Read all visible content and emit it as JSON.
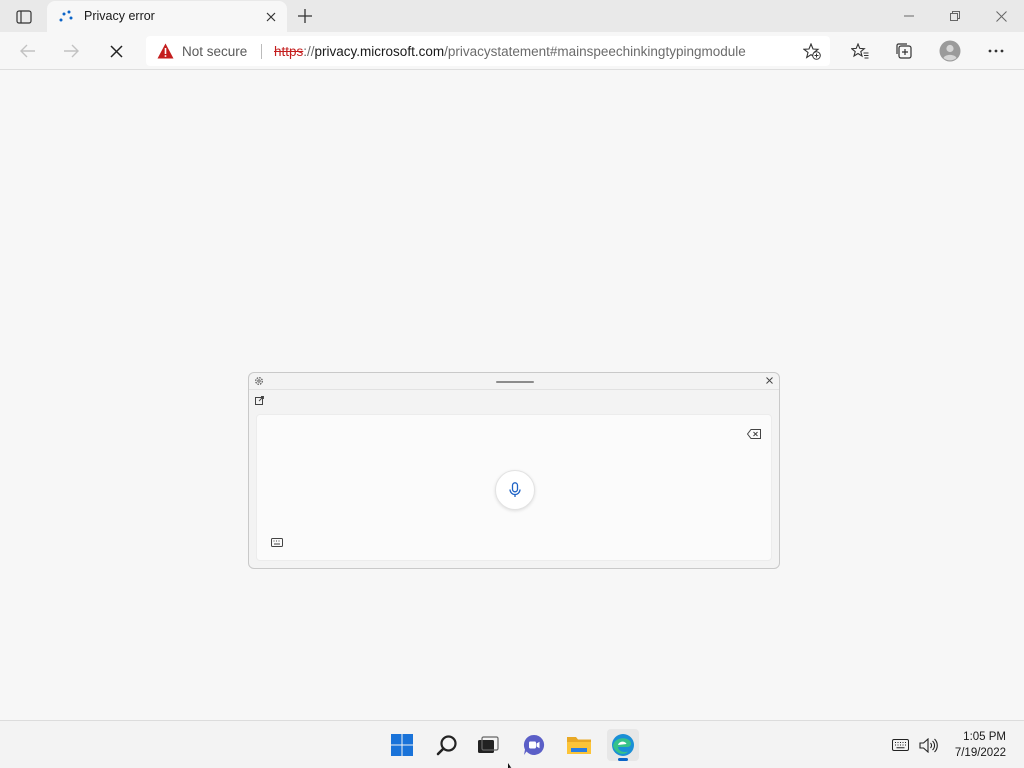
{
  "browser": {
    "tab": {
      "title": "Privacy error",
      "favicon": "loading-spinner-icon"
    },
    "address_bar": {
      "security_label": "Not secure",
      "url_scheme": "https",
      "url_host": "privacy.microsoft.com",
      "url_rest": "/privacystatement#mainspeechinkingtypingmodule"
    }
  },
  "taskbar": {
    "apps": [
      "start-icon",
      "search-icon",
      "task-view-icon",
      "chat-icon",
      "file-explorer-icon",
      "edge-icon"
    ],
    "clock": {
      "time": "1:05 PM",
      "date": "7/19/2022"
    }
  },
  "colors": {
    "page_bg": "#f7f7f7",
    "tabstrip_bg": "#e9e9e9",
    "warning_red": "#c41e1e",
    "accent_blue": "#0a64c8"
  }
}
